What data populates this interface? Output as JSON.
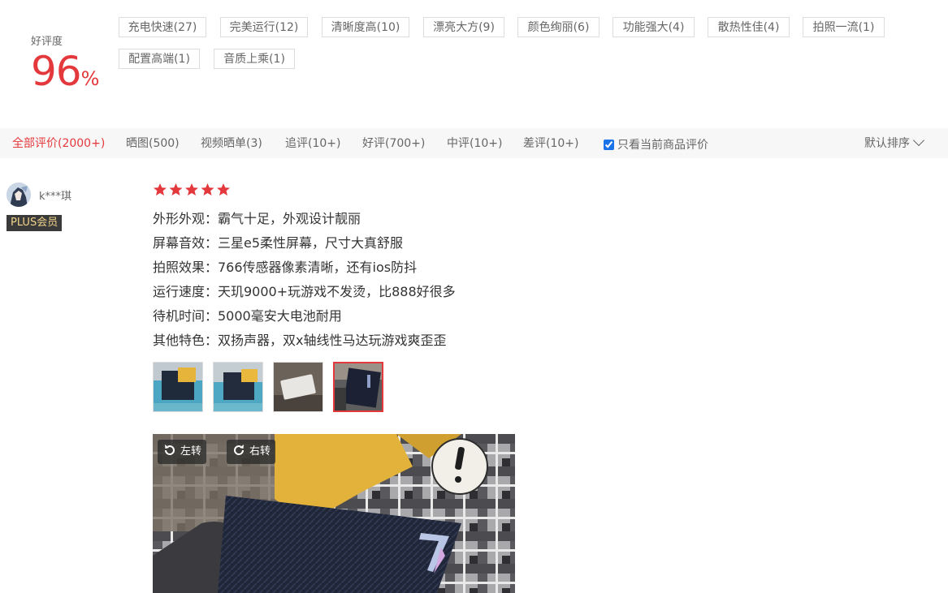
{
  "rating": {
    "label": "好评度",
    "value": "96",
    "unit": "%"
  },
  "tags": [
    "充电快速(27)",
    "完美运行(12)",
    "清晰度高(10)",
    "漂亮大方(9)",
    "颜色绚丽(6)",
    "功能强大(4)",
    "散热性佳(4)",
    "拍照一流(1)",
    "配置高端(1)",
    "音质上乘(1)"
  ],
  "tabs": [
    "全部评价(2000+)",
    "晒图(500)",
    "视频晒单(3)",
    "追评(10+)",
    "好评(700+)",
    "中评(10+)",
    "差评(10+)"
  ],
  "filter": {
    "only_current": "只看当前商品评价",
    "checked": true
  },
  "sort": {
    "label": "默认排序"
  },
  "review": {
    "user": {
      "name": "k***琪",
      "badge": "PLUS会员",
      "avatar_icon": "avatar-icon"
    },
    "stars": 5,
    "lines": [
      "外形外观：霸气十足，外观设计靓丽",
      "屏幕音效：三星e5柔性屏幕，尺寸大真舒服",
      "拍照效果：766传感器像素清晰，还有ios防抖",
      "运行速度：天玑9000+玩游戏不发烫，比888好很多",
      "待机时间：5000毫安大电池耐用",
      "其他特色：双扬声器，双x轴线性马达玩游戏爽歪歪"
    ],
    "rotate_left": "左转",
    "rotate_right": "右转"
  },
  "colors": {
    "accent": "#e4393c",
    "tab_bg": "#f7f7f7",
    "badge_bg": "#3a3a3a",
    "badge_text": "#f2d58b"
  }
}
